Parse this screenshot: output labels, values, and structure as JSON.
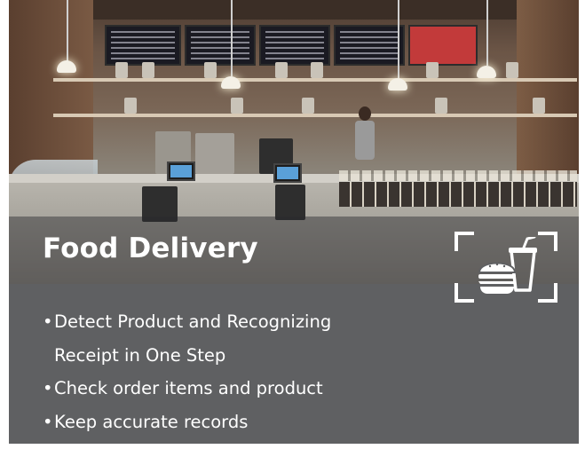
{
  "card": {
    "title": "Food Delivery",
    "icon": "burger-drink-icon",
    "bullet_char": "•",
    "bullets": [
      {
        "line1": "Detect Product and Recognizing",
        "line2": "Receipt in One Step"
      },
      {
        "line1": "Check order items and product"
      },
      {
        "line1": "Keep accurate records"
      }
    ]
  },
  "colors": {
    "panel": "#5f6062",
    "text": "#ffffff"
  }
}
